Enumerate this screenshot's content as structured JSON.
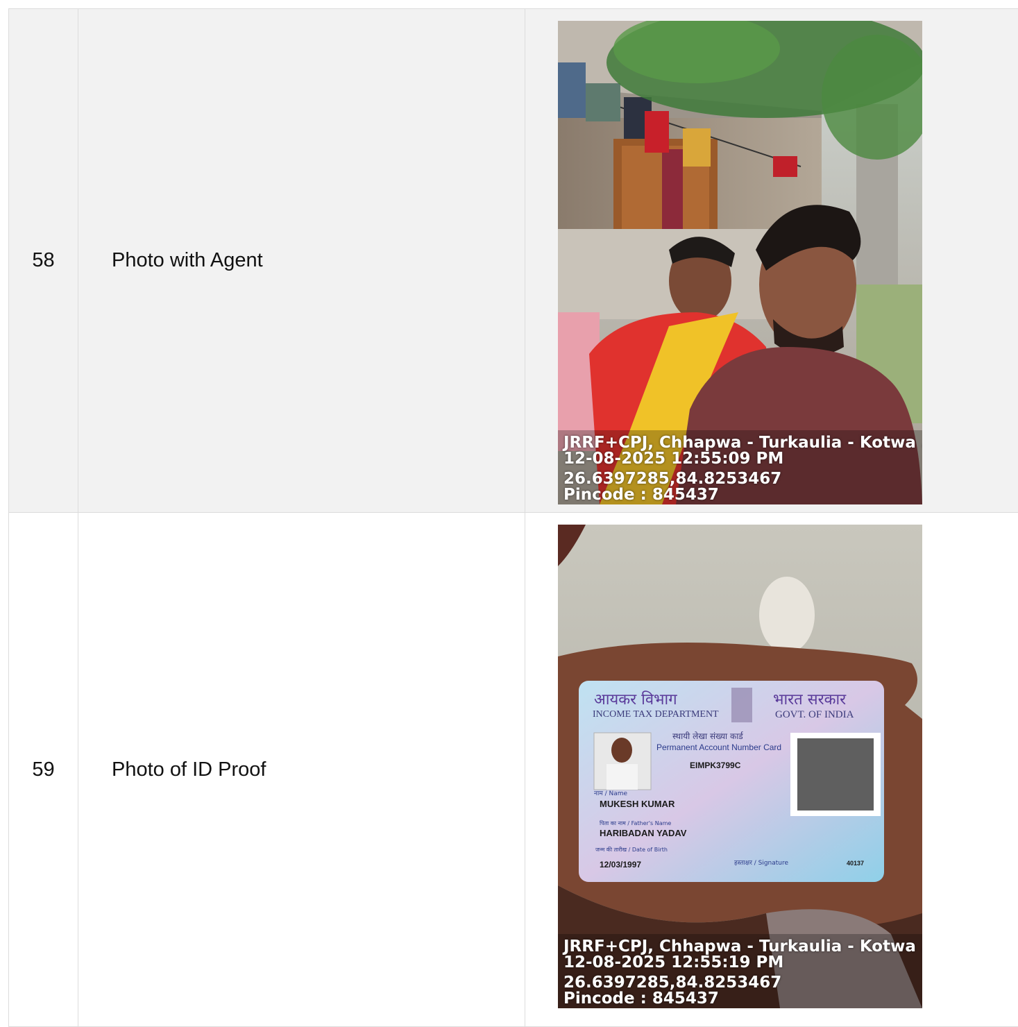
{
  "rows": [
    {
      "number": "58",
      "label": "Photo with Agent",
      "photo": {
        "icon": "selfie-photo",
        "overlay": {
          "location": "JRRF+CPJ, Chhapwa - Turkaulia - Kotwa ...",
          "datetime": "12-08-2025 12:55:09 PM",
          "coords": "26.6397285,84.8253467",
          "pincode": "Pincode : 845437"
        }
      }
    },
    {
      "number": "59",
      "label": "Photo of ID Proof",
      "photo": {
        "icon": "pan-card-photo",
        "card": {
          "dept_hindi": "आयकर विभाग",
          "dept_english": "INCOME TAX DEPARTMENT",
          "govt_hindi": "भारत सरकार",
          "govt_english": "GOVT. OF INDIA",
          "card_title_hindi": "स्थायी लेखा संख्या कार्ड",
          "card_title_english": "Permanent Account Number Card",
          "pan_number": "EIMPK3799C",
          "name_label": "नाम / Name",
          "name": "MUKESH KUMAR",
          "father_label": "पिता का नाम / Father's Name",
          "father_name": "HARIBADAN YADAV",
          "dob_label": "जन्म की तारीख / Date of Birth",
          "dob": "12/03/1997",
          "signature_label": "हस्ताक्षर / Signature",
          "serial": "40137"
        },
        "overlay": {
          "location": "JRRF+CPJ, Chhapwa - Turkaulia - Kotwa ...",
          "datetime": "12-08-2025 12:55:19 PM",
          "coords": "26.6397285,84.8253467",
          "pincode": "Pincode : 845437"
        }
      }
    }
  ]
}
